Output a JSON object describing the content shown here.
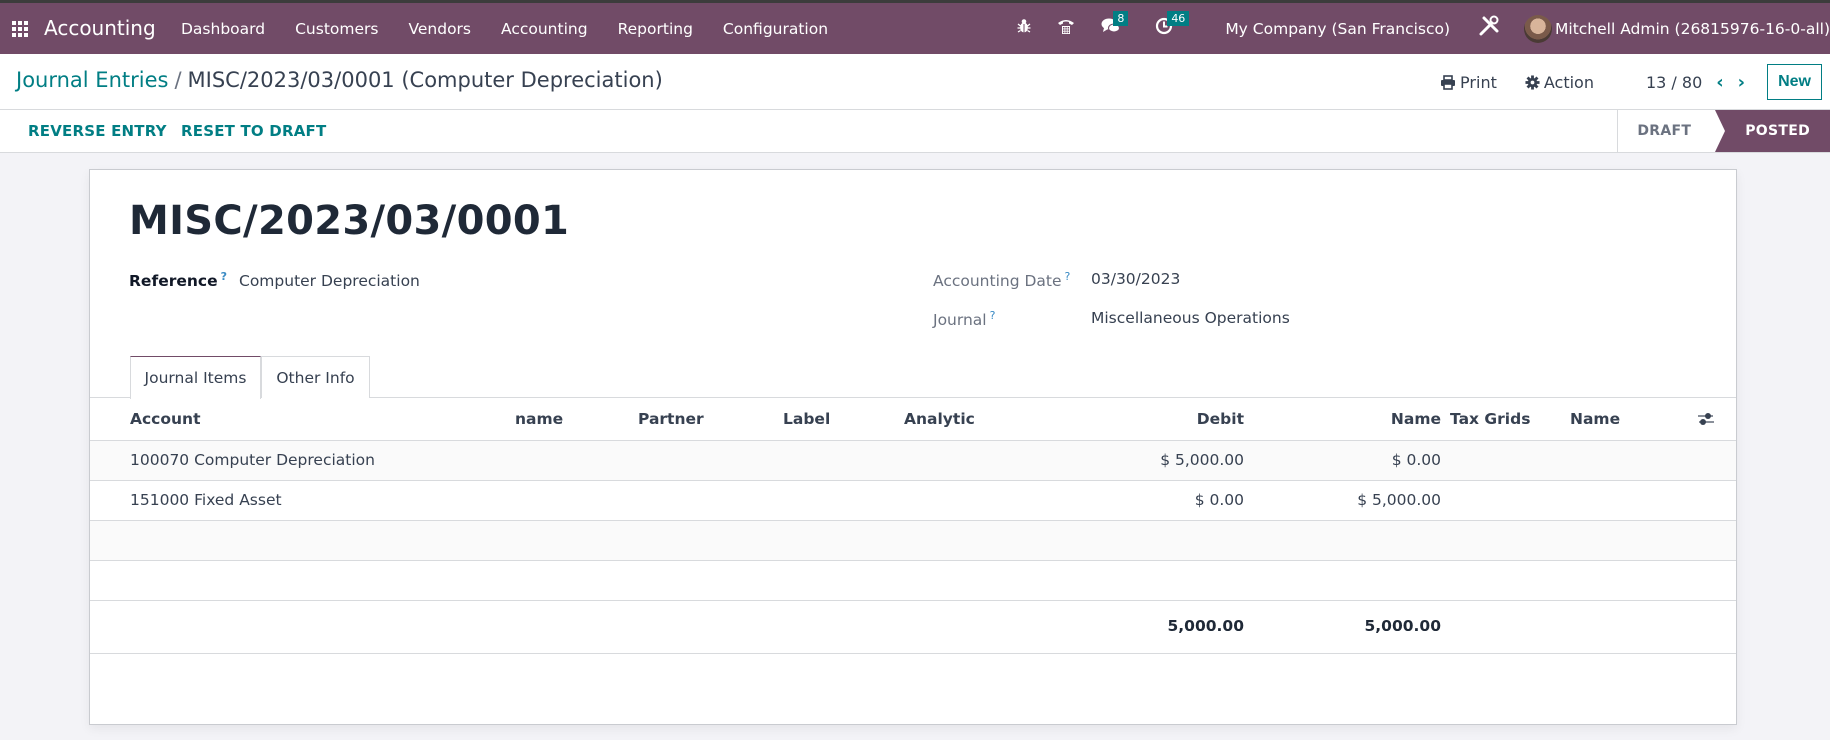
{
  "navbar": {
    "app_name": "Accounting",
    "menu": [
      "Dashboard",
      "Customers",
      "Vendors",
      "Accounting",
      "Reporting",
      "Configuration"
    ],
    "messages_badge": "8",
    "activities_badge": "46",
    "company": "My Company (San Francisco)",
    "user": "Mitchell Admin (26815976-16-0-all)"
  },
  "control_panel": {
    "breadcrumb_parent": "Journal Entries",
    "breadcrumb_separator": "/",
    "breadcrumb_current": "MISC/2023/03/0001 (Computer Depreciation)",
    "print_label": "Print",
    "action_label": "Action",
    "pager": "13 / 80",
    "new_label": "New"
  },
  "statusbar": {
    "buttons": [
      "REVERSE ENTRY",
      "RESET TO DRAFT"
    ],
    "stages": [
      "DRAFT",
      "POSTED"
    ],
    "current_stage": "POSTED"
  },
  "form": {
    "title": "MISC/2023/03/0001",
    "reference_label": "Reference",
    "reference_value": "Computer Depreciation",
    "accounting_date_label": "Accounting Date",
    "accounting_date_value": "03/30/2023",
    "journal_label": "Journal",
    "journal_value": "Miscellaneous Operations",
    "help_mark": "?"
  },
  "tabs": [
    "Journal Items",
    "Other Info"
  ],
  "active_tab": "Journal Items",
  "table": {
    "columns": [
      "Account",
      "name",
      "Partner",
      "Label",
      "Analytic",
      "Debit",
      "Name",
      "Tax Grids",
      "Name"
    ],
    "rows": [
      {
        "account": "100070 Computer Depreciation",
        "debit": "$ 5,000.00",
        "credit": "$ 0.00"
      },
      {
        "account": "151000 Fixed Asset",
        "debit": "$ 0.00",
        "credit": "$ 5,000.00"
      }
    ],
    "totals": {
      "debit": "5,000.00",
      "credit": "5,000.00"
    }
  },
  "colors": {
    "brand": "#714b67",
    "accent": "#017e84"
  }
}
